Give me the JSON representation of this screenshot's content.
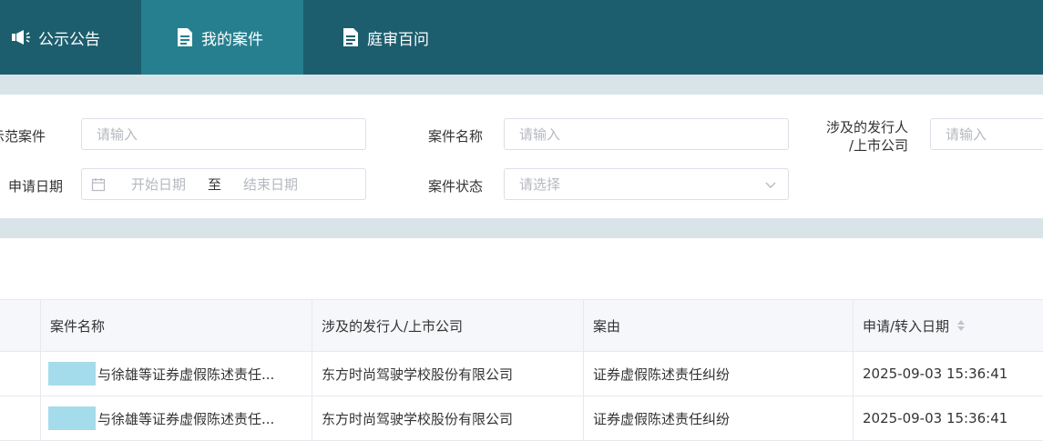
{
  "nav": {
    "items": [
      {
        "label": "公示公告",
        "icon": "megaphone-icon",
        "active": false
      },
      {
        "label": "我的案件",
        "icon": "document-icon",
        "active": true
      },
      {
        "label": "庭审百问",
        "icon": "document-icon",
        "active": false
      }
    ]
  },
  "filters": {
    "demo_case_label": "示范案件",
    "demo_case_placeholder": "请输入",
    "case_name_label": "案件名称",
    "case_name_placeholder": "请输入",
    "issuer_label_line1": "涉及的发行人",
    "issuer_label_line2": "/上市公司",
    "issuer_placeholder": "请输入",
    "apply_date_label": "申请日期",
    "start_date_placeholder": "开始日期",
    "date_separator": "至",
    "end_date_placeholder": "结束日期",
    "case_status_label": "案件状态",
    "case_status_placeholder": "请选择"
  },
  "table": {
    "headers": [
      "案件名称",
      "涉及的发行人/上市公司",
      "案由",
      "申请/转入日期"
    ],
    "rows": [
      {
        "case_name": "与徐雄等证券虚假陈述责任...",
        "issuer": "东方时尚驾驶学校股份有限公司",
        "cause": "证券虚假陈述责任纠纷",
        "date": "2025-09-03 15:36:41"
      },
      {
        "case_name": "与徐雄等证券虚假陈述责任...",
        "issuer": "东方时尚驾驶学校股份有限公司",
        "cause": "证券虚假陈述责任纠纷",
        "date": "2025-09-03 15:36:41"
      }
    ]
  }
}
